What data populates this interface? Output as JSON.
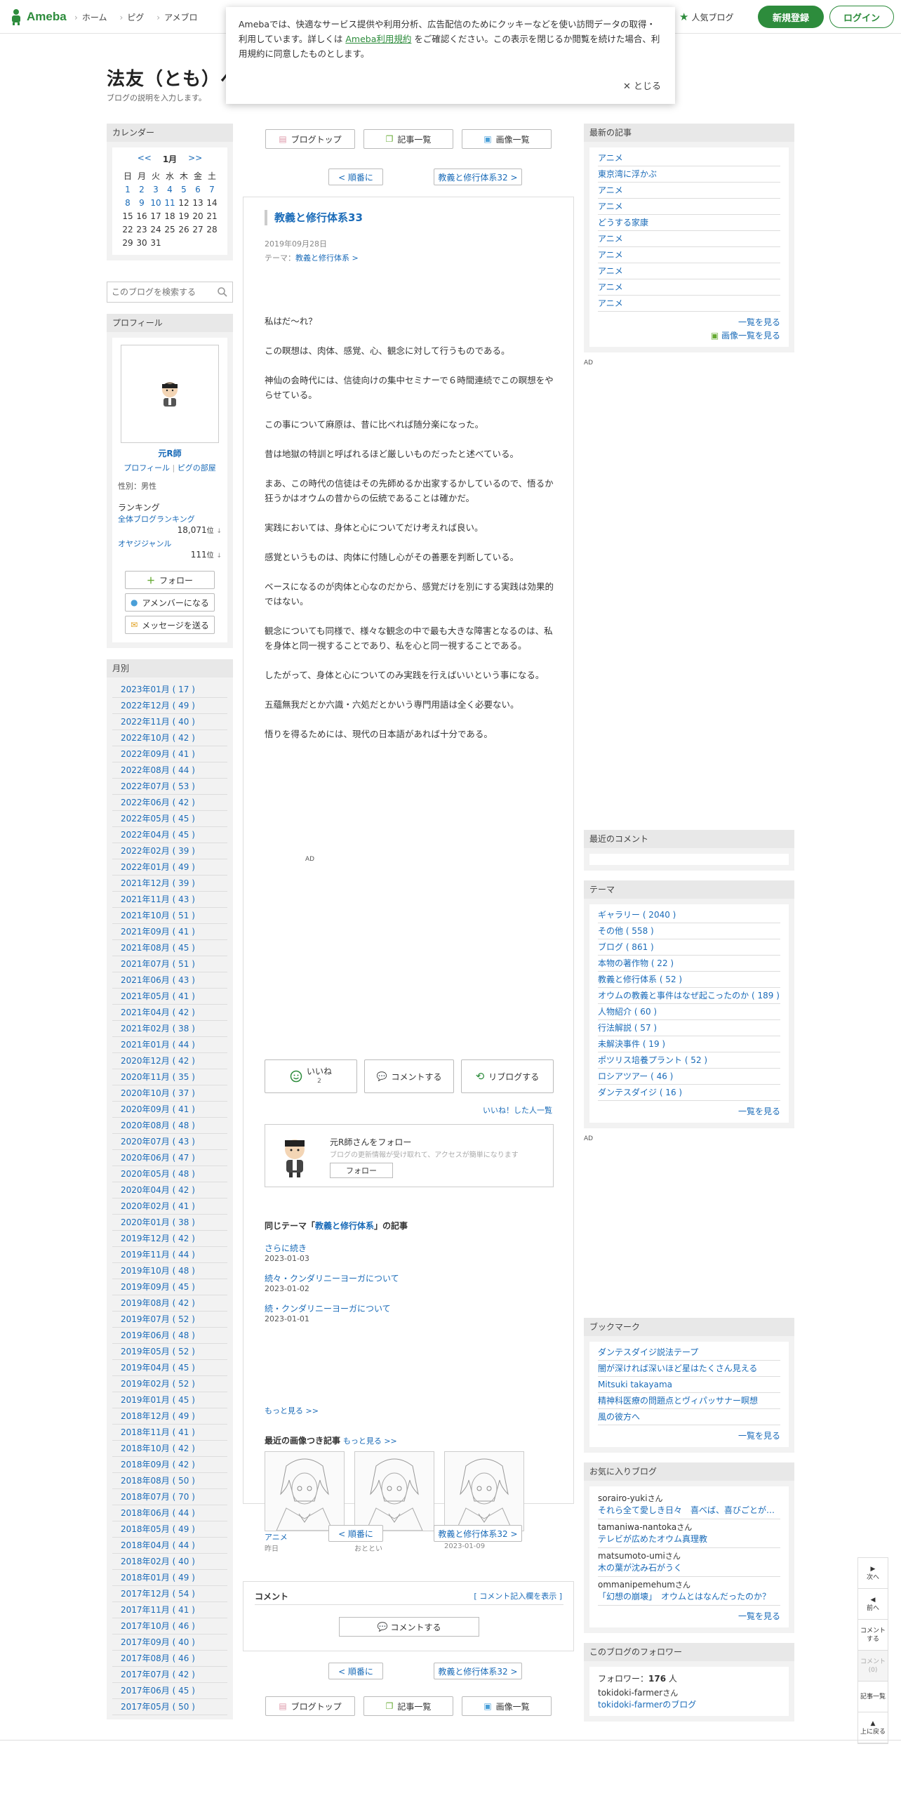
{
  "header": {
    "logo": "Ameba",
    "nav": [
      "ホーム",
      "ピグ",
      "アメブロ"
    ],
    "popular_blog": "人気ブログ",
    "register": "新規登録",
    "login": "ログイン"
  },
  "cookie": {
    "text_before": "Amebaでは、快適なサービス提供や利用分析、広告配信のためにクッキーなどを使い訪問データの取得・利用しています。詳しくは ",
    "tos_link": "Ameba利用規約",
    "text_after": " をご確認ください。この表示を閉じるか閲覧を続けた場合、利用規約に同意したものとします。",
    "close": "とじる"
  },
  "blog": {
    "title": "法友（とも）へ",
    "description": "ブログの説明を入力します。"
  },
  "calendar": {
    "heading": "カレンダー",
    "prev": "<<",
    "month": "1月",
    "next": ">>",
    "weekdays": [
      "日",
      "月",
      "火",
      "水",
      "木",
      "金",
      "土"
    ],
    "weeks": [
      [
        "1",
        "2",
        "3",
        "4",
        "5",
        "6",
        "7"
      ],
      [
        "8",
        "9",
        "10",
        "11",
        "12",
        "13",
        "14"
      ],
      [
        "15",
        "16",
        "17",
        "18",
        "19",
        "20",
        "21"
      ],
      [
        "22",
        "23",
        "24",
        "25",
        "26",
        "27",
        "28"
      ],
      [
        "29",
        "30",
        "31",
        "",
        "",
        "",
        ""
      ]
    ],
    "linked_days": [
      "1",
      "2",
      "3",
      "4",
      "5",
      "6",
      "7",
      "8",
      "9",
      "10",
      "11"
    ]
  },
  "search": {
    "placeholder": "このブログを検索する"
  },
  "profile": {
    "heading": "プロフィール",
    "name": "元R師",
    "profile_link": "プロフィール",
    "sep": "|",
    "pigg_link": "ピグの部屋",
    "gender": "性別：男性",
    "ranking_label": "ランキング",
    "overall_ranking": "全体ブログランキング",
    "overall_rank": "18,071",
    "genre_ranking": "オヤジジャンル",
    "genre_rank": "111",
    "rank_unit": "位",
    "follow_btn": "フォロー",
    "amember_btn": "アメンバーになる",
    "message_btn": "メッセージを送る"
  },
  "archive": {
    "heading": "月別",
    "items": [
      "2023年01月 ( 17 )",
      "2022年12月 ( 49 )",
      "2022年11月 ( 40 )",
      "2022年10月 ( 42 )",
      "2022年09月 ( 41 )",
      "2022年08月 ( 44 )",
      "2022年07月 ( 53 )",
      "2022年06月 ( 42 )",
      "2022年05月 ( 45 )",
      "2022年04月 ( 45 )",
      "2022年02月 ( 39 )",
      "2022年01月 ( 49 )",
      "2021年12月 ( 39 )",
      "2021年11月 ( 43 )",
      "2021年10月 ( 51 )",
      "2021年09月 ( 41 )",
      "2021年08月 ( 45 )",
      "2021年07月 ( 51 )",
      "2021年06月 ( 43 )",
      "2021年05月 ( 41 )",
      "2021年04月 ( 42 )",
      "2021年02月 ( 38 )",
      "2021年01月 ( 44 )",
      "2020年12月 ( 42 )",
      "2020年11月 ( 35 )",
      "2020年10月 ( 37 )",
      "2020年09月 ( 41 )",
      "2020年08月 ( 48 )",
      "2020年07月 ( 43 )",
      "2020年06月 ( 47 )",
      "2020年05月 ( 48 )",
      "2020年04月 ( 42 )",
      "2020年02月 ( 41 )",
      "2020年01月 ( 38 )",
      "2019年12月 ( 42 )",
      "2019年11月 ( 44 )",
      "2019年10月 ( 48 )",
      "2019年09月 ( 45 )",
      "2019年08月 ( 42 )",
      "2019年07月 ( 52 )",
      "2019年06月 ( 48 )",
      "2019年05月 ( 52 )",
      "2019年04月 ( 45 )",
      "2019年02月 ( 52 )",
      "2019年01月 ( 45 )",
      "2018年12月 ( 49 )",
      "2018年11月 ( 41 )",
      "2018年10月 ( 42 )",
      "2018年09月 ( 42 )",
      "2018年08月 ( 50 )",
      "2018年07月 ( 70 )",
      "2018年06月 ( 44 )",
      "2018年05月 ( 49 )",
      "2018年04月 ( 44 )",
      "2018年02月 ( 40 )",
      "2018年01月 ( 49 )",
      "2017年12月 ( 54 )",
      "2017年11月 ( 41 )",
      "2017年10月 ( 46 )",
      "2017年09月 ( 40 )",
      "2017年08月 ( 46 )",
      "2017年07月 ( 42 )",
      "2017年06月 ( 45 )",
      "2017年05月 ( 50 )"
    ]
  },
  "main": {
    "blog_top": "ブログトップ",
    "entry_list": "記事一覧",
    "image_list": "画像一覧",
    "prev_entry": "< 順番に",
    "next_entry": "教義と修行体系32 >",
    "article": {
      "title": "教義と修行体系33",
      "date": "2019年09月28日",
      "theme_label": "テーマ：",
      "theme": "教義と修行体系 >",
      "paragraphs": [
        "私はだ～れ？",
        "この瞑想は、肉体、感覚、心、観念に対して行うものである。",
        "神仙の会時代には、信徒向けの集中セミナーで６時間連続でこの瞑想をやらせている。",
        "この事について麻原は、昔に比べれば随分楽になった。",
        "昔は地獄の特訓と呼ばれるほど厳しいものだったと述べている。",
        "まあ、この時代の信徒はその先師めるか出家するかしているので、悟るか狂うかはオウムの昔からの伝統であることは確かだ。",
        "",
        "実践においては、身体と心についてだけ考えれば良い。",
        "感覚というものは、肉体に付随し心がその善悪を判断している。",
        "ベースになるのが肉体と心なのだから、感覚だけを別にする実践は効果的ではない。",
        "観念についても同様で、様々な観念の中で最も大きな障害となるのは、私を身体と同一視することであり、私を心と同一視することである。",
        "したがって、身体と心についてのみ実践を行えばいいという事になる。",
        "五蘊無我だとか六識・六処だとかいう専門用語は全く必要ない。",
        "悟りを得るためには、現代の日本語があれば十分である。"
      ],
      "ad": "AD"
    },
    "like": "いいね",
    "like_count": "2",
    "comment_btn": "コメントする",
    "reblog": "リブログする",
    "liked_list": "いいね！した人一覧",
    "follow_box": {
      "title": "元R師さんをフォロー",
      "desc": "ブログの更新情報が受け取れて、アクセスが簡単になります",
      "button": "フォロー"
    },
    "same_theme": {
      "prefix": "同じテーマ「",
      "theme": "教義と修行体系",
      "suffix": "」の記事",
      "items": [
        {
          "title": "さらに続き",
          "date": "2023-01-03"
        },
        {
          "title": "続々・クンダリニーヨーガについて",
          "date": "2023-01-02"
        },
        {
          "title": "続・クンダリニーヨーガについて",
          "date": "2023-01-01"
        }
      ],
      "more": "もっと見る >>"
    },
    "recent_images": {
      "heading": "最近の画像つき記事",
      "more": "もっと見る >>",
      "items": [
        {
          "title": "アニメ",
          "date": "昨日"
        },
        {
          "title": "アニメ",
          "date": "おととい"
        },
        {
          "title": "アニメ",
          "date": "2023-01-09"
        }
      ]
    },
    "comments": {
      "heading": "コメント",
      "show_form": "[ コメント記入欄を表示 ]",
      "button": "コメントする"
    }
  },
  "right": {
    "recent_heading": "最新の記事",
    "recent_items": [
      "アニメ",
      "東京湾に浮かぶ",
      "アニメ",
      "アニメ",
      "どうする家康",
      "アニメ",
      "アニメ",
      "アニメ",
      "アニメ",
      "アニメ"
    ],
    "recent_more": "一覧を見る",
    "recent_images": "画像一覧を見る",
    "ad": "AD",
    "recent_comments_heading": "最近のコメント",
    "theme_heading": "テーマ",
    "themes": [
      "ギャラリー ( 2040 )",
      "その他 ( 558 )",
      "ブログ ( 861 )",
      "本物の著作物 ( 22 )",
      "教義と修行体系 ( 52 )",
      "オウムの教義と事件はなぜ起こったのか ( 189 )",
      "人物紹介 ( 60 )",
      "行法解説 ( 57 )",
      "未解決事件 ( 19 )",
      "ポツリス培養プラント ( 52 )",
      "ロシアツアー ( 46 )",
      "ダンテスダイジ ( 16 )"
    ],
    "theme_more": "一覧を見る",
    "bookmark_heading": "ブックマーク",
    "bookmarks": [
      "ダンテスダイジ説法テープ",
      "闇が深ければ深いほど星はたくさん見える",
      "Mitsuki takayama",
      "精神科医療の問題点とヴィパッサナー瞑想",
      "風の彼方へ"
    ],
    "bookmark_more": "一覧を見る",
    "fav_heading": "お気に入りブログ",
    "favs": [
      {
        "user": "sorairo-yuki",
        "post": "それら全て愛しき日々　喜べば、喜びごとが…"
      },
      {
        "user": "tamaniwa-nantoka",
        "post": "テレビが広めたオウム真理教"
      },
      {
        "user": "matsumoto-umi",
        "post": "木の葉が沈み石がうく"
      },
      {
        "user": "ommanipemehum",
        "post": "「幻想の崩壊」　オウムとはなんだったのか？"
      }
    ],
    "san": "さん",
    "fav_more": "一覧を見る",
    "follower_heading": "このブログのフォロワー",
    "follower_label": "フォロワー：",
    "follower_count": "176",
    "follower_unit": "人",
    "follower_user": "tokidoki-farmer",
    "follower_blog": "tokidoki-farmerのブログ"
  },
  "floatnav": [
    "次へ",
    "前へ",
    "コメントする",
    "コメント(0)",
    "記事一覧",
    "上に戻る"
  ]
}
